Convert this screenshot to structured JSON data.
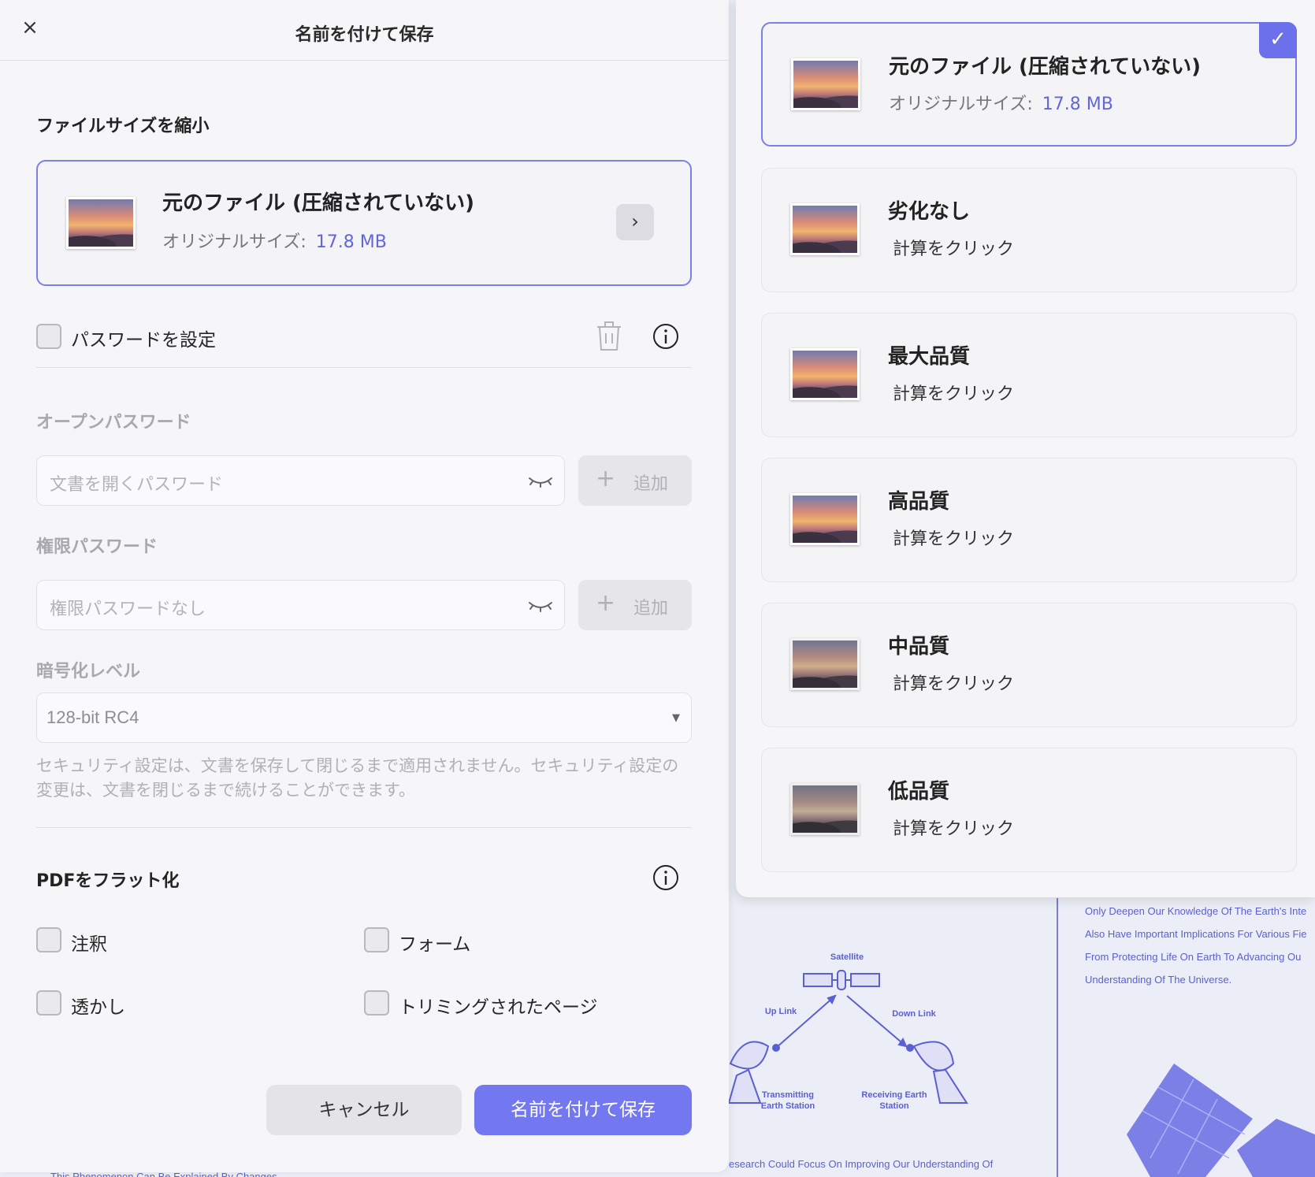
{
  "dialog": {
    "title": "名前を付けて保存",
    "close_glyph": "×"
  },
  "compress": {
    "section_title": "ファイルサイズを縮小",
    "card_title": "元のファイル (圧縮されていない)",
    "size_label": "オリジナルサイズ:",
    "size_value": "17.8 MB",
    "chevron": "›"
  },
  "password": {
    "checkbox_label": "パスワードを設定",
    "checked": false,
    "open_title": "オープンパスワード",
    "open_placeholder": "文書を開くパスワード",
    "perm_title": "権限パスワード",
    "perm_placeholder": "権限パスワードなし",
    "add_label": "追加",
    "add_glyph": "+",
    "enc_title": "暗号化レベル",
    "enc_value": "128-bit RC4",
    "enc_arrow": "▼",
    "note": "セキュリティ設定は、文書を保存して閉じるまで適用されません。セキュリティ設定の変更は、文書を閉じるまで続けることができます。"
  },
  "flatten": {
    "section_title": "PDFをフラット化",
    "options": [
      {
        "label": "注釈",
        "checked": false
      },
      {
        "label": "フォーム",
        "checked": false
      },
      {
        "label": "透かし",
        "checked": false
      },
      {
        "label": "トリミングされたページ",
        "checked": false
      }
    ]
  },
  "buttons": {
    "cancel": "キャンセル",
    "save": "名前を付けて保存"
  },
  "quality_options": [
    {
      "title": "元のファイル (圧縮されていない)",
      "size_label": "オリジナルサイズ:",
      "size_value": "17.8 MB",
      "selected": true,
      "check": "✓"
    },
    {
      "title": "劣化なし",
      "sub": "計算をクリック",
      "selected": false
    },
    {
      "title": "最大品質",
      "sub": "計算をクリック",
      "selected": false
    },
    {
      "title": "高品質",
      "sub": "計算をクリック",
      "selected": false
    },
    {
      "title": "中品質",
      "sub": "計算をクリック",
      "selected": false
    },
    {
      "title": "低品質",
      "sub": "計算をクリック",
      "selected": false
    }
  ],
  "background": {
    "paragraph": [
      "Only Deepen Our Knowledge Of The Earth's Inte",
      "Also Have Important Implications For Various Fie",
      "From Protecting Life On Earth To Advancing Ou",
      "Understanding Of The Universe."
    ],
    "diagram": {
      "satellite": "Satellite",
      "uplink": "Up Link",
      "downlink": "Down Link",
      "transmitting": "Transmitting Earth Station",
      "receiving": "Receiving Earth Station"
    },
    "bottom_line": "esearch Could Focus On Improving Our Understanding Of",
    "cut_line": "This Phenomenon Can Be Explained By Changes"
  },
  "colors": {
    "accent": "#7378f0",
    "accent_text": "#6366d9",
    "selected_border": "#7b7fe8",
    "doc_ink": "#5b5fd0"
  }
}
